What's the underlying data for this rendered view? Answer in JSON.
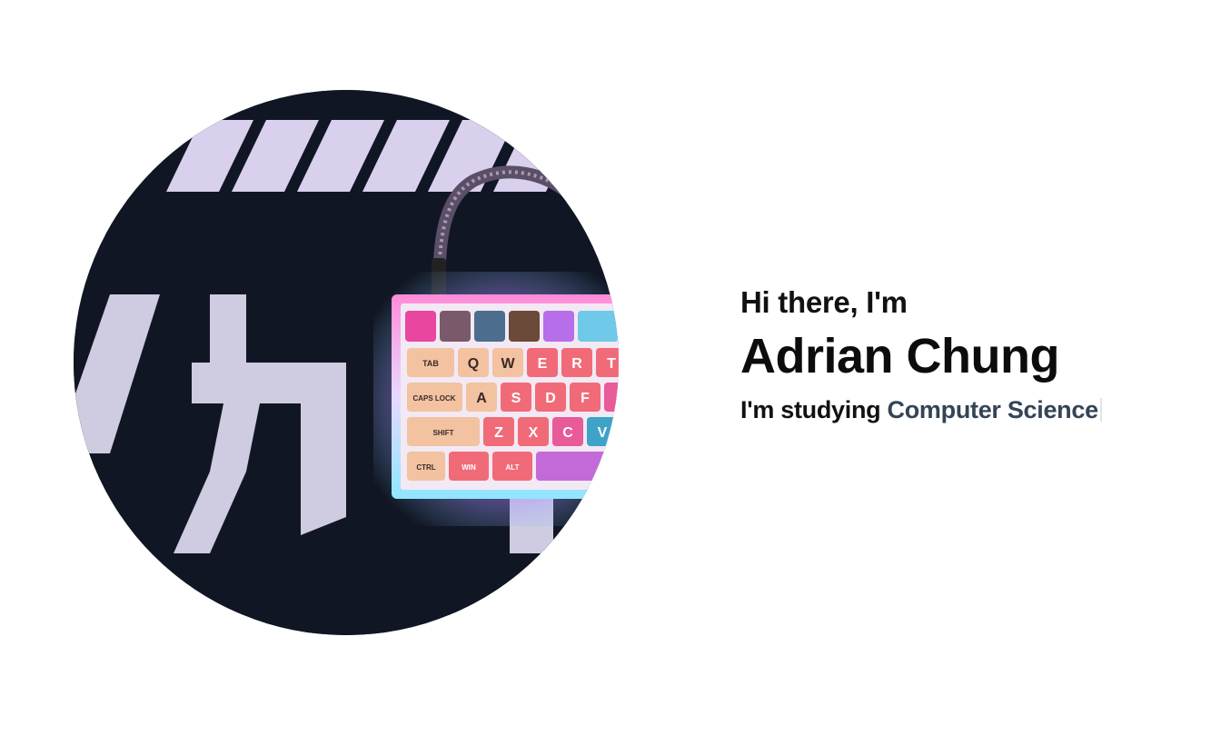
{
  "hero": {
    "photo_alt": "mechanical keyboard",
    "greeting": "Hi there, I'm",
    "name": "Adrian Chung",
    "studying_prefix": "I'm studying",
    "studying_subject": "Computer Science"
  },
  "keyboard": {
    "keys": [
      "TAB",
      "Q",
      "W",
      "E",
      "R",
      "T",
      "CAPS LOCK",
      "A",
      "S",
      "D",
      "F",
      "SHIFT",
      "Z",
      "X",
      "C",
      "V",
      "CTRL",
      "WIN",
      "ALT"
    ]
  },
  "colors": {
    "background": "#ffffff",
    "text": "#111111",
    "subject": "#344455",
    "mat": "#101522",
    "keycap_peach": "#f3c2a0",
    "keycap_red": "#f06b77"
  }
}
